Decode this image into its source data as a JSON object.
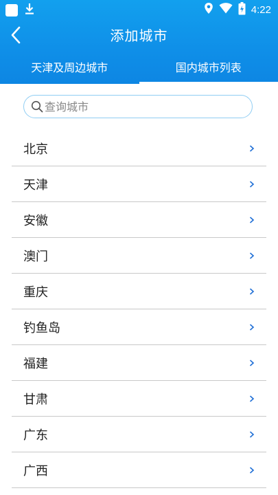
{
  "status": {
    "time": "4:22",
    "icons": [
      "app-square-icon",
      "download-icon",
      "location-icon",
      "wifi-icon",
      "battery-icon"
    ]
  },
  "header": {
    "title": "添加城市",
    "back_icon": "chevron-left-icon"
  },
  "tabs": [
    {
      "label": "天津及周边城市",
      "active": false
    },
    {
      "label": "国内城市列表",
      "active": true
    }
  ],
  "search": {
    "placeholder": "查询城市",
    "value": ""
  },
  "cities": [
    {
      "name": "北京"
    },
    {
      "name": "天津"
    },
    {
      "name": "安徽"
    },
    {
      "name": "澳门"
    },
    {
      "name": "重庆"
    },
    {
      "name": "钓鱼岛"
    },
    {
      "name": "福建"
    },
    {
      "name": "甘肃"
    },
    {
      "name": "广东"
    },
    {
      "name": "广西"
    }
  ],
  "colors": {
    "header_blue": "#0f8fe8",
    "search_border": "#8fcdf3",
    "chevron_blue": "#1f6fd6"
  }
}
